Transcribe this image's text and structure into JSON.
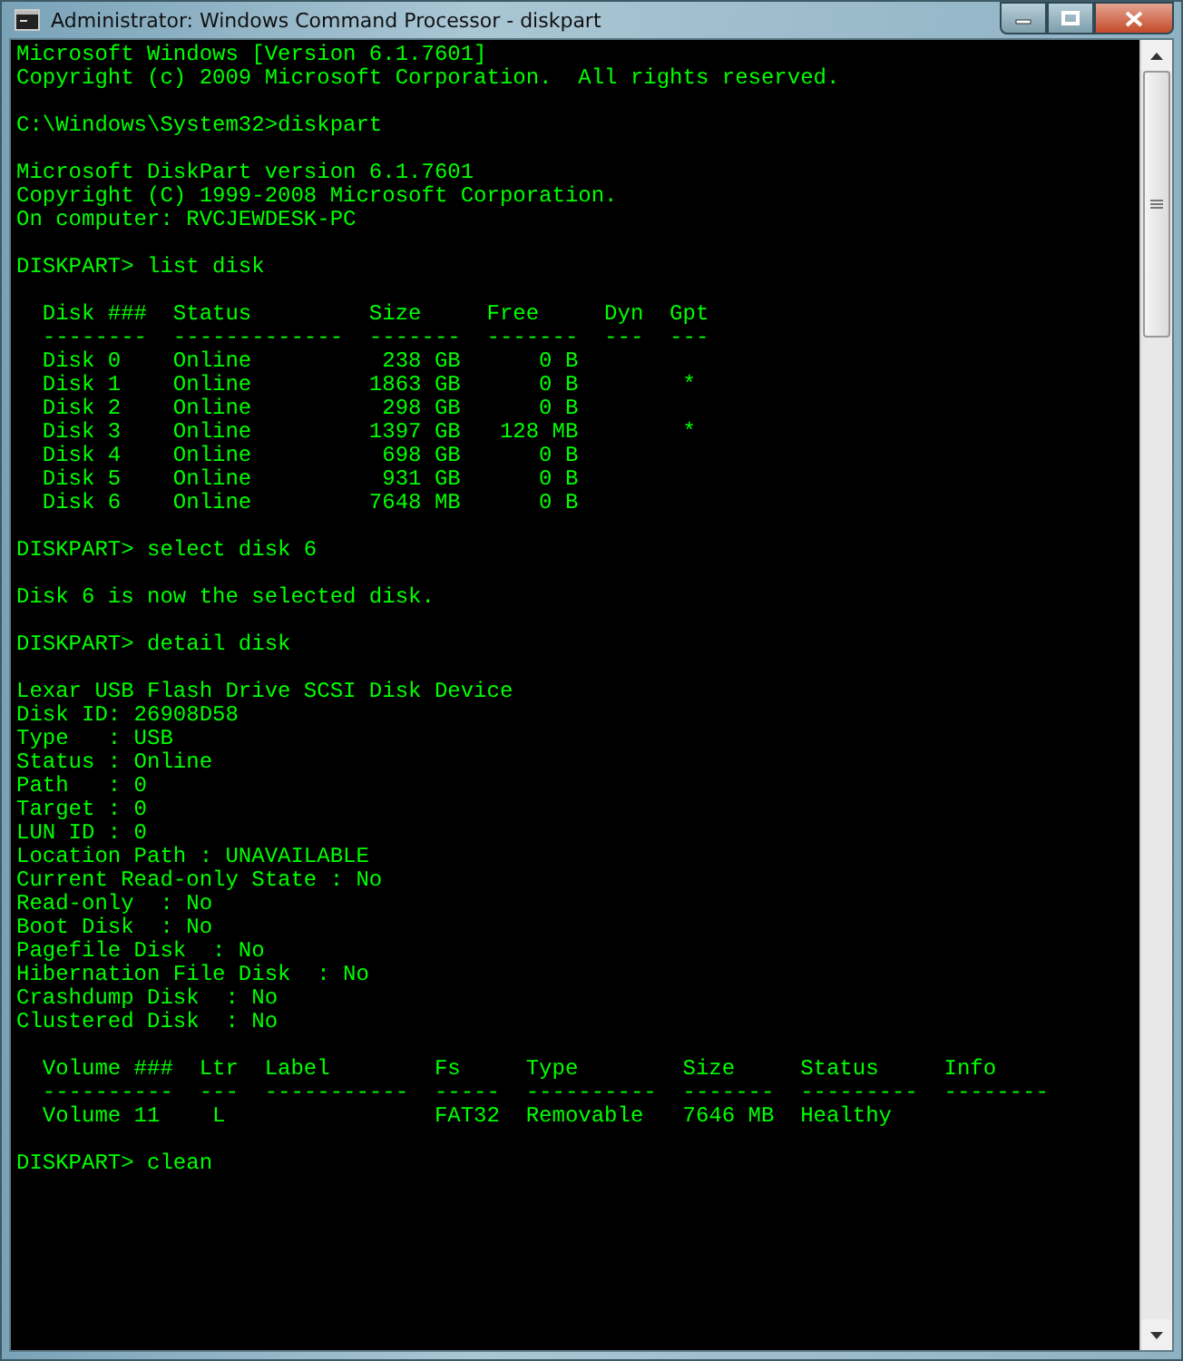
{
  "window": {
    "title": "Administrator: Windows Command Processor - diskpart"
  },
  "console": {
    "blocks": [
      [
        "Microsoft Windows [Version 6.1.7601]",
        "Copyright (c) 2009 Microsoft Corporation.  All rights reserved."
      ],
      [
        "C:\\Windows\\System32>diskpart"
      ],
      [
        "Microsoft DiskPart version 6.1.7601",
        "Copyright (C) 1999-2008 Microsoft Corporation.",
        "On computer: RVCJEWDESK-PC"
      ],
      [
        "DISKPART> list disk"
      ],
      [
        "  Disk ###  Status         Size     Free     Dyn  Gpt",
        "  --------  -------------  -------  -------  ---  ---",
        "  Disk 0    Online          238 GB      0 B",
        "  Disk 1    Online         1863 GB      0 B        *",
        "  Disk 2    Online          298 GB      0 B",
        "  Disk 3    Online         1397 GB   128 MB        *",
        "  Disk 4    Online          698 GB      0 B",
        "  Disk 5    Online          931 GB      0 B",
        "  Disk 6    Online         7648 MB      0 B"
      ],
      [
        "DISKPART> select disk 6"
      ],
      [
        "Disk 6 is now the selected disk."
      ],
      [
        "DISKPART> detail disk"
      ],
      [
        "Lexar USB Flash Drive SCSI Disk Device",
        "Disk ID: 26908D58",
        "Type   : USB",
        "Status : Online",
        "Path   : 0",
        "Target : 0",
        "LUN ID : 0",
        "Location Path : UNAVAILABLE",
        "Current Read-only State : No",
        "Read-only  : No",
        "Boot Disk  : No",
        "Pagefile Disk  : No",
        "Hibernation File Disk  : No",
        "Crashdump Disk  : No",
        "Clustered Disk  : No"
      ],
      [
        "  Volume ###  Ltr  Label        Fs     Type        Size     Status     Info",
        "  ----------  ---  -----------  -----  ----------  -------  ---------  --------",
        "  Volume 11    L                FAT32  Removable   7646 MB  Healthy"
      ],
      [
        "DISKPART> clean"
      ]
    ]
  }
}
